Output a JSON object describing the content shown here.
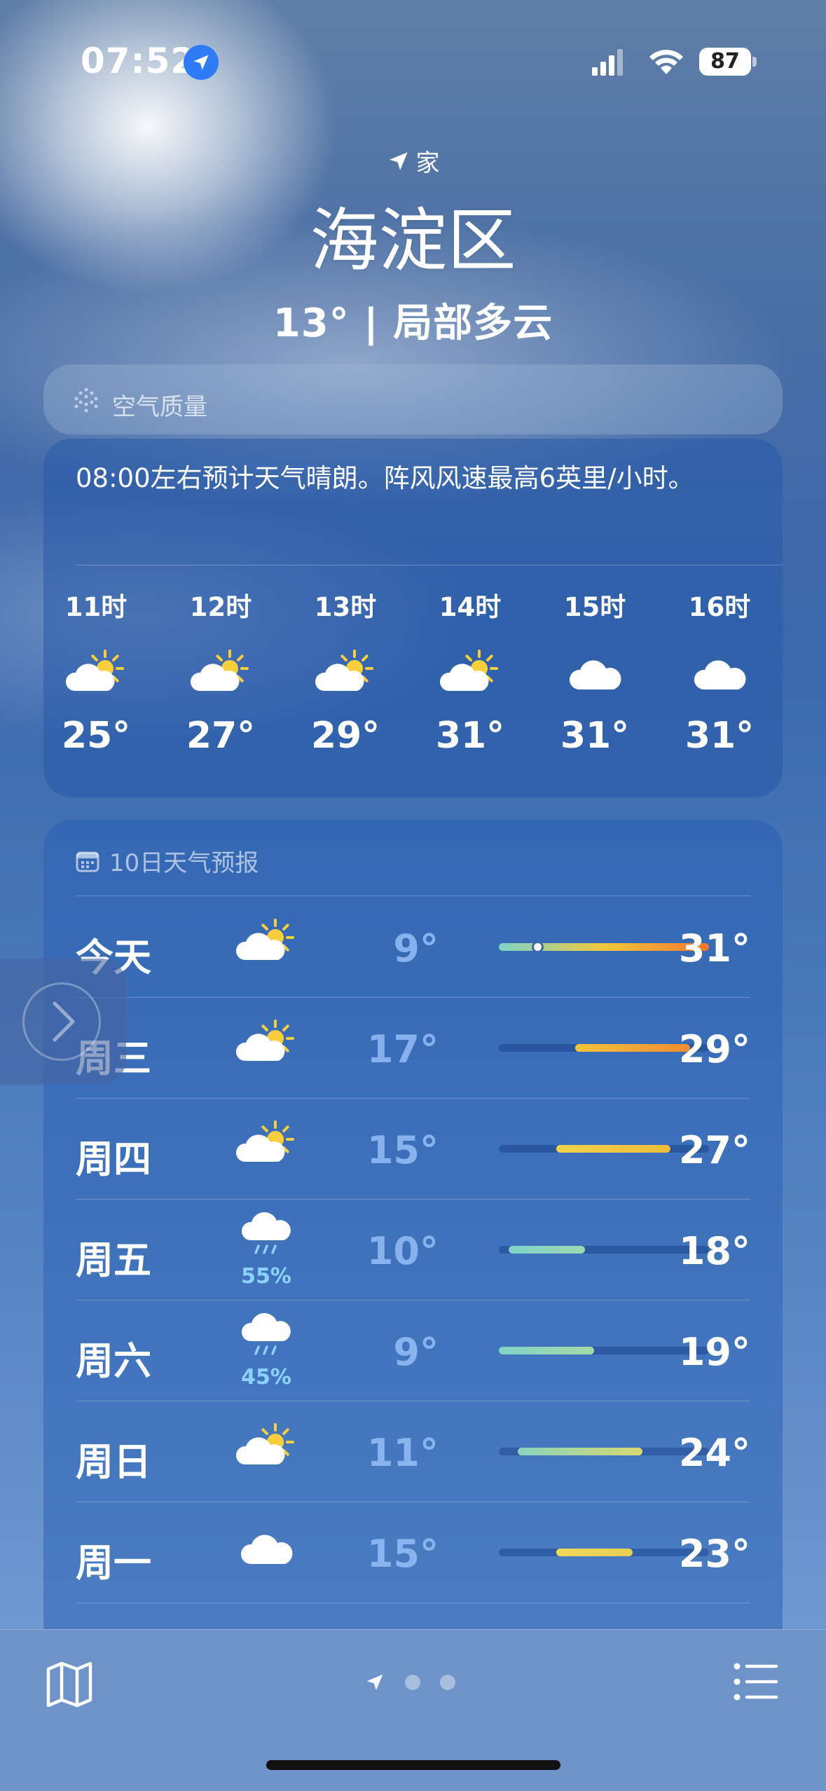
{
  "status_bar": {
    "time": "07:52",
    "battery": "87"
  },
  "location": {
    "home_label": "家",
    "city": "海淀区",
    "current": "13° | 局部多云"
  },
  "air_quality": {
    "label": "空气质量"
  },
  "hourly": {
    "summary": "08:00左右预计天气晴朗。阵风风速最高6英里/小时。",
    "hours": [
      {
        "time": "11时",
        "icon": "partly-sunny-icon",
        "temp": "25°"
      },
      {
        "time": "12时",
        "icon": "partly-sunny-icon",
        "temp": "27°"
      },
      {
        "time": "13时",
        "icon": "partly-sunny-icon",
        "temp": "29°"
      },
      {
        "time": "14时",
        "icon": "partly-sunny-icon",
        "temp": "31°"
      },
      {
        "time": "15时",
        "icon": "cloud-icon",
        "temp": "31°"
      },
      {
        "time": "16时",
        "icon": "cloud-icon",
        "temp": "31°"
      }
    ]
  },
  "daily": {
    "title": "10日天气预报",
    "scale": {
      "min": 9,
      "max": 31
    },
    "days": [
      {
        "day": "今天",
        "icon": "partly-sunny-icon",
        "precip": "",
        "low": "9°",
        "high": "31°",
        "low_value": 9,
        "high_value": 31,
        "current_value": 13,
        "colors": [
          "#7fd3c9",
          "#f0c93a",
          "#f2762e"
        ]
      },
      {
        "day": "周三",
        "icon": "partly-sunny-icon",
        "precip": "",
        "low": "17°",
        "high": "29°",
        "low_value": 17,
        "high_value": 29,
        "colors": [
          "#f2c53d",
          "#f08b30"
        ]
      },
      {
        "day": "周四",
        "icon": "partly-sunny-icon",
        "precip": "",
        "low": "15°",
        "high": "27°",
        "low_value": 15,
        "high_value": 27,
        "colors": [
          "#f3d24c",
          "#f0bc3b"
        ]
      },
      {
        "day": "周五",
        "icon": "rain-icon",
        "precip": "55%",
        "low": "10°",
        "high": "18°",
        "low_value": 10,
        "high_value": 18,
        "colors": [
          "#7fd3c9",
          "#9cd8b0"
        ]
      },
      {
        "day": "周六",
        "icon": "rain-icon",
        "precip": "45%",
        "low": "9°",
        "high": "19°",
        "low_value": 9,
        "high_value": 19,
        "colors": [
          "#7fd3c9",
          "#a6d9a4"
        ]
      },
      {
        "day": "周日",
        "icon": "partly-sunny-icon",
        "precip": "",
        "low": "11°",
        "high": "24°",
        "low_value": 11,
        "high_value": 24,
        "colors": [
          "#89d4bf",
          "#d8d870"
        ]
      },
      {
        "day": "周一",
        "icon": "cloud-icon",
        "precip": "",
        "low": "15°",
        "high": "23°",
        "low_value": 15,
        "high_value": 23,
        "colors": [
          "#f0d85a",
          "#e8cf55"
        ]
      }
    ]
  },
  "pager": {
    "pages": 3
  }
}
